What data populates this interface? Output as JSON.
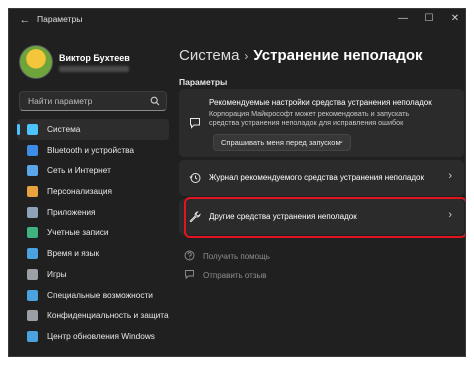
{
  "window": {
    "title": "Параметры",
    "controls": {
      "minimize": "—",
      "maximize": "☐",
      "close": "✕"
    },
    "back_icon": "←"
  },
  "sidebar": {
    "user": {
      "name": "Виктор Бухтеев"
    },
    "search": {
      "placeholder": "Найти параметр"
    },
    "items": [
      {
        "label": "Система",
        "icon": "monitor-icon",
        "color": "#4cc2ff",
        "active": true
      },
      {
        "label": "Bluetooth и устройства",
        "icon": "bluetooth-icon",
        "color": "#3d8ce6"
      },
      {
        "label": "Сеть и Интернет",
        "icon": "network-icon",
        "color": "#5aa6e8"
      },
      {
        "label": "Персонализация",
        "icon": "brush-icon",
        "color": "#e8a23d"
      },
      {
        "label": "Приложения",
        "icon": "apps-icon",
        "color": "#8ea2b8"
      },
      {
        "label": "Учетные записи",
        "icon": "person-icon",
        "color": "#3fb27f"
      },
      {
        "label": "Время и язык",
        "icon": "globe-icon",
        "color": "#4aa3df"
      },
      {
        "label": "Игры",
        "icon": "gamepad-icon",
        "color": "#9aa0a6"
      },
      {
        "label": "Специальные возможности",
        "icon": "accessibility-icon",
        "color": "#4aa3df"
      },
      {
        "label": "Конфиденциальность и защита",
        "icon": "shield-icon",
        "color": "#9aa0a6"
      },
      {
        "label": "Центр обновления Windows",
        "icon": "update-icon",
        "color": "#4aa3df"
      }
    ]
  },
  "main": {
    "breadcrumb": {
      "parent": "Система",
      "separator": "›",
      "current": "Устранение неполадок"
    },
    "section_label": "Параметры",
    "recommended": {
      "title": "Рекомендуемые настройки средства устранения неполадок",
      "description": "Корпорация Майкрософт может рекомендовать и запускать средства устранения неполадок для исправления ошибок",
      "dropdown_value": "Спрашивать меня перед запуском",
      "icon": "chat-icon"
    },
    "history": {
      "label": "Журнал рекомендуемого средства устранения неполадок",
      "icon": "history-icon"
    },
    "other": {
      "label": "Другие средства устранения неполадок",
      "icon": "wrench-icon"
    },
    "links": {
      "help": "Получить помощь",
      "feedback": "Отправить отзыв"
    }
  },
  "colors": {
    "accent": "#4cc2ff",
    "highlight": "#e2141f",
    "background": "#202020",
    "card": "#2b2b2b"
  }
}
